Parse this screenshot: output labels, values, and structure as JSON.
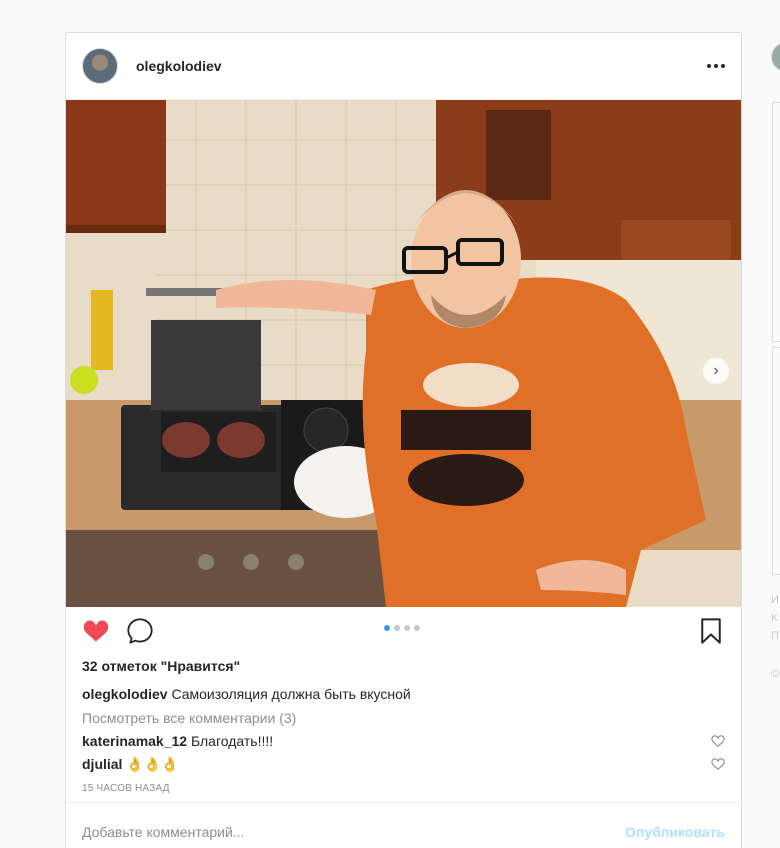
{
  "post": {
    "username": "olegkolodiev",
    "likes_text": "32 отметок \"Нравится\"",
    "caption": {
      "username": "olegkolodiev",
      "text": "Самоизоляция должна быть вкусной"
    },
    "view_all_comments": "Посмотреть все комментарии (3)",
    "comments": [
      {
        "username": "katerinamak_12",
        "text": "Благодать!!!!"
      },
      {
        "username": "djulial",
        "text": "👌👌👌"
      }
    ],
    "timestamp": "15 часов назад",
    "carousel": {
      "count": 4,
      "active_index": 0
    },
    "liked": true
  },
  "comment_box": {
    "placeholder": "Добавьте комментарий...",
    "publish_label": "Опубликовать"
  },
  "sidebar": {
    "fragments": [
      "И",
      "К",
      "П",
      "©"
    ]
  },
  "colors": {
    "like_red": "#ed4956",
    "link_blue": "#3897f0",
    "publish_disabled": "#b2dffc",
    "border": "#dbdbdb"
  },
  "icons": [
    "more-icon",
    "heart-icon",
    "comment-icon",
    "bookmark-icon",
    "chevron-right-icon"
  ]
}
